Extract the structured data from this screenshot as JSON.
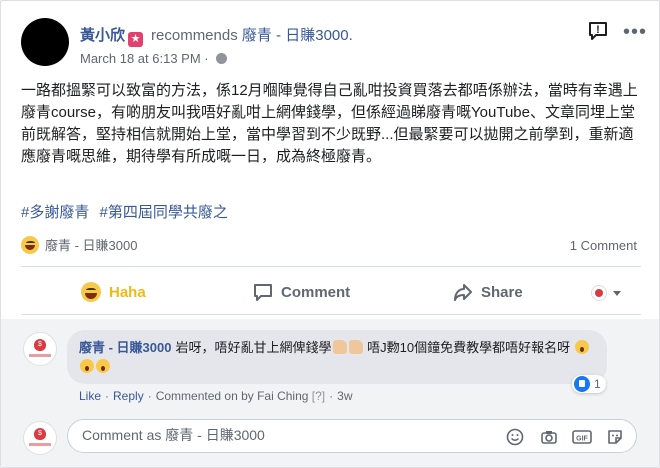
{
  "post": {
    "author": "黃小欣",
    "recommends_text": "recommends",
    "page_name": "廢青 - 日賺3000.",
    "timestamp": "March 18 at 6:13 PM",
    "timestamp_sep": "·",
    "body": "一路都搵緊可以致富的方法，係12月嗰陣覺得自己亂咁投資買落去都唔係辦法，當時有幸遇上廢青course，有啲朋友叫我唔好亂咁上網俾錢學，但係經過睇廢青嘅YouTube、文章同埋上堂前既解答，堅持相信就開始上堂，當中學習到不少既野...但最緊要可以拋開之前學到，重新適應廢青嘅思維，期待學有所成嘅一日，成為終極廢青。",
    "hashtags": [
      "#多謝廢青",
      "#第四屆同學共廢之"
    ],
    "reaction_by": "廢青 - 日賺3000",
    "comment_count": "1 Comment",
    "more_dots": "•••",
    "report_label": "!"
  },
  "actions": {
    "haha": "Haha",
    "comment": "Comment",
    "share": "Share"
  },
  "comment": {
    "author": "廢青 - 日賺3000",
    "text_1": "岩呀，唔好亂甘上網俾錢學",
    "text_2": "唔J覅10個鐘免費教學都唔好報名呀",
    "like_count": "1",
    "like_label": "Like",
    "reply_label": "Reply",
    "commented_on_by": "Commented on by Fai Ching",
    "help_mark": "[?]",
    "age": "3w",
    "sep": "·"
  },
  "composer": {
    "placeholder": "Comment as 廢青 - 日賺3000"
  },
  "colors": {
    "link": "#385898",
    "haha": "#f0ba15",
    "like_badge": "#1877f2",
    "brand_red": "#d93b40"
  }
}
